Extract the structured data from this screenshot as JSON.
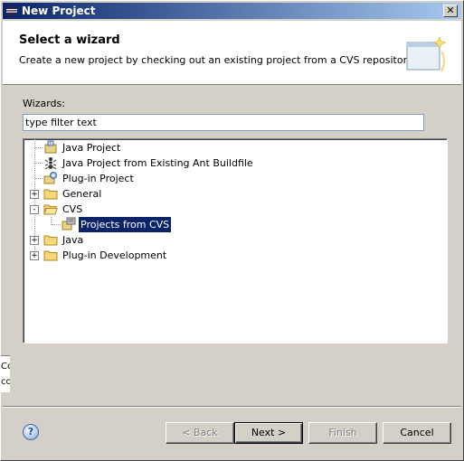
{
  "window": {
    "title": "New Project"
  },
  "banner": {
    "title": "Select a wizard",
    "description": "Create a new project by checking out an existing project from a CVS repository."
  },
  "filter": {
    "label": "Wizards:",
    "value": "type filter text"
  },
  "tree": {
    "items": [
      {
        "label": "Java Project",
        "icon": "java-project-icon"
      },
      {
        "label": "Java Project from Existing Ant Buildfile",
        "icon": "ant-icon"
      },
      {
        "label": "Plug-in Project",
        "icon": "plugin-project-icon"
      },
      {
        "label": "General",
        "icon": "folder-icon",
        "expander": "+"
      },
      {
        "label": "CVS",
        "icon": "folder-open-icon",
        "expander": "-"
      },
      {
        "label": "Projects from CVS",
        "icon": "cvs-icon",
        "selected": true
      },
      {
        "label": "Java",
        "icon": "folder-icon",
        "expander": "+"
      },
      {
        "label": "Plug-in Development",
        "icon": "folder-icon",
        "expander": "+"
      }
    ]
  },
  "background_strip": {
    "line1": "Co",
    "line2": "co"
  },
  "buttons": {
    "help": "?",
    "back": "< Back",
    "next": "Next >",
    "finish": "Finish",
    "cancel": "Cancel"
  },
  "colors": {
    "selection": "#0a246a",
    "title_gradient_start": "#0a246a",
    "title_gradient_end": "#a6caf0"
  }
}
